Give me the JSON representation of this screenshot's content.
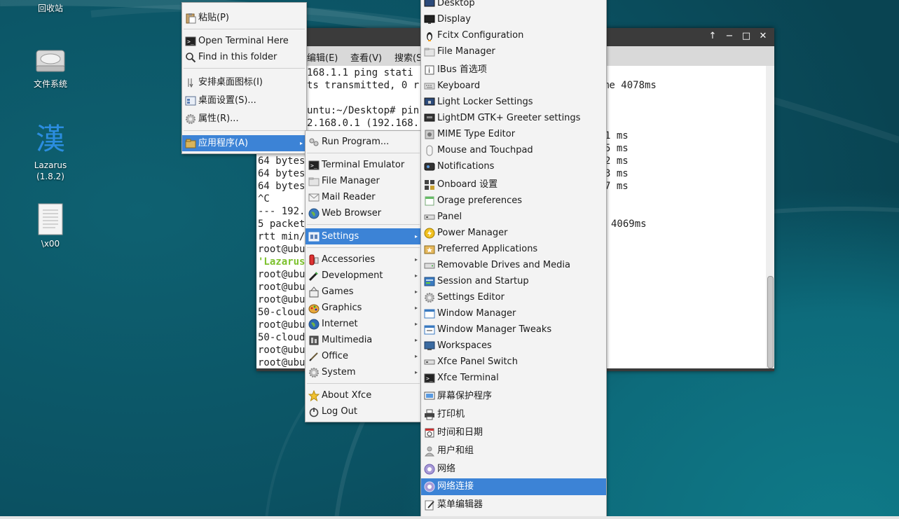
{
  "desktop": {
    "icons": [
      {
        "label": "回收站",
        "icon": "trash-icon"
      },
      {
        "label": "文件系统",
        "icon": "drive-icon"
      },
      {
        "label": "Lazarus\n(1.8.2)",
        "icon": "han-glyph-icon",
        "glyph": "漢"
      },
      {
        "label": "\\x00",
        "icon": "document-icon"
      }
    ]
  },
  "terminal": {
    "window_controls": [
      "↑",
      "−",
      "□",
      "✕"
    ],
    "menubar": [
      "编辑(E)",
      "查看(V)",
      "搜索(S"
    ],
    "lines": [
      "168.1.1 ping stati",
      "ts transmitted, 0 r",
      "",
      "untu:~/Desktop# pin",
      "2.168.0.1 (192.168."
    ],
    "right_texts": [
      "me 4078ms",
      "1 ms",
      "5 ms",
      "2 ms",
      "3 ms",
      "7 ms",
      "4069ms"
    ],
    "lower_lines": [
      "64 bytes",
      "64 bytes",
      "64 bytes",
      "^C",
      "--- 192.",
      "5 packet",
      "rtt min/",
      "root@ubu",
      "'Lazarus",
      "root@ubu",
      "root@ubu",
      "root@ubu",
      "50-cloud",
      "root@ubu",
      "50-cloud",
      "root@ubu",
      "root@ubu"
    ]
  },
  "context_menu": {
    "items": [
      {
        "label": "粘贴(P)",
        "icon": "paste-icon"
      },
      {
        "label": "Open Terminal Here",
        "icon": "terminal-icon"
      },
      {
        "label": "Find in this folder",
        "icon": "search-icon"
      },
      {
        "label": "安排桌面图标(I)",
        "icon": "arrange-icon"
      },
      {
        "label": "桌面设置(S)...",
        "icon": "desktop-settings-icon"
      },
      {
        "label": "属性(R)...",
        "icon": "gear-icon"
      },
      {
        "label": "应用程序(A)",
        "icon": "applications-icon",
        "selected": true
      }
    ]
  },
  "apps_menu": {
    "items": [
      {
        "label": "Run Program...",
        "icon": "run-icon"
      },
      {
        "label": "Terminal Emulator",
        "icon": "terminal-icon"
      },
      {
        "label": "File Manager",
        "icon": "folder-icon"
      },
      {
        "label": "Mail Reader",
        "icon": "mail-icon"
      },
      {
        "label": "Web Browser",
        "icon": "globe-icon"
      },
      {
        "label": "Settings",
        "icon": "settings-icon",
        "selected": true
      },
      {
        "label": "Accessories",
        "icon": "accessories-icon"
      },
      {
        "label": "Development",
        "icon": "development-icon"
      },
      {
        "label": "Games",
        "icon": "games-icon"
      },
      {
        "label": "Graphics",
        "icon": "graphics-icon"
      },
      {
        "label": "Internet",
        "icon": "internet-icon"
      },
      {
        "label": "Multimedia",
        "icon": "multimedia-icon"
      },
      {
        "label": "Office",
        "icon": "office-icon"
      },
      {
        "label": "System",
        "icon": "system-icon"
      },
      {
        "label": "About Xfce",
        "icon": "star-icon"
      },
      {
        "label": "Log Out",
        "icon": "power-icon"
      }
    ]
  },
  "settings_menu": {
    "items": [
      {
        "label": "Desktop",
        "icon": "monitor-icon"
      },
      {
        "label": "Display",
        "icon": "display-icon"
      },
      {
        "label": "Fcitx Configuration",
        "icon": "fcitx-icon"
      },
      {
        "label": "File Manager",
        "icon": "folder-icon"
      },
      {
        "label": "IBus 首选项",
        "icon": "ibus-icon"
      },
      {
        "label": "Keyboard",
        "icon": "keyboard-icon"
      },
      {
        "label": "Light Locker Settings",
        "icon": "locker-icon"
      },
      {
        "label": "LightDM GTK+ Greeter settings",
        "icon": "greeter-icon"
      },
      {
        "label": "MIME Type Editor",
        "icon": "mime-icon"
      },
      {
        "label": "Mouse and Touchpad",
        "icon": "mouse-icon"
      },
      {
        "label": "Notifications",
        "icon": "notifications-icon"
      },
      {
        "label": "Onboard 设置",
        "icon": "onboard-icon"
      },
      {
        "label": "Orage preferences",
        "icon": "calendar-icon"
      },
      {
        "label": "Panel",
        "icon": "panel-icon"
      },
      {
        "label": "Power Manager",
        "icon": "power-manager-icon"
      },
      {
        "label": "Preferred Applications",
        "icon": "preferred-apps-icon"
      },
      {
        "label": "Removable Drives and Media",
        "icon": "drive-icon"
      },
      {
        "label": "Session and Startup",
        "icon": "session-icon"
      },
      {
        "label": "Settings Editor",
        "icon": "gear-icon"
      },
      {
        "label": "Window Manager",
        "icon": "window-icon"
      },
      {
        "label": "Window Manager Tweaks",
        "icon": "window-tweaks-icon"
      },
      {
        "label": "Workspaces",
        "icon": "workspaces-icon"
      },
      {
        "label": "Xfce Panel Switch",
        "icon": "panel-switch-icon"
      },
      {
        "label": "Xfce Terminal",
        "icon": "terminal-icon"
      },
      {
        "label": "屏幕保护程序",
        "icon": "screensaver-icon"
      },
      {
        "label": "打印机",
        "icon": "printer-icon"
      },
      {
        "label": "时间和日期",
        "icon": "clock-icon"
      },
      {
        "label": "用户和组",
        "icon": "users-icon"
      },
      {
        "label": "网络",
        "icon": "network-icon"
      },
      {
        "label": "网络连接",
        "icon": "network-connections-icon",
        "selected": true
      },
      {
        "label": "菜单编辑器",
        "icon": "menu-editor-icon"
      }
    ]
  },
  "colors": {
    "selection": "#3c83d6",
    "desktop": "#0b5263",
    "lazarus_green": "#7cc12c"
  }
}
